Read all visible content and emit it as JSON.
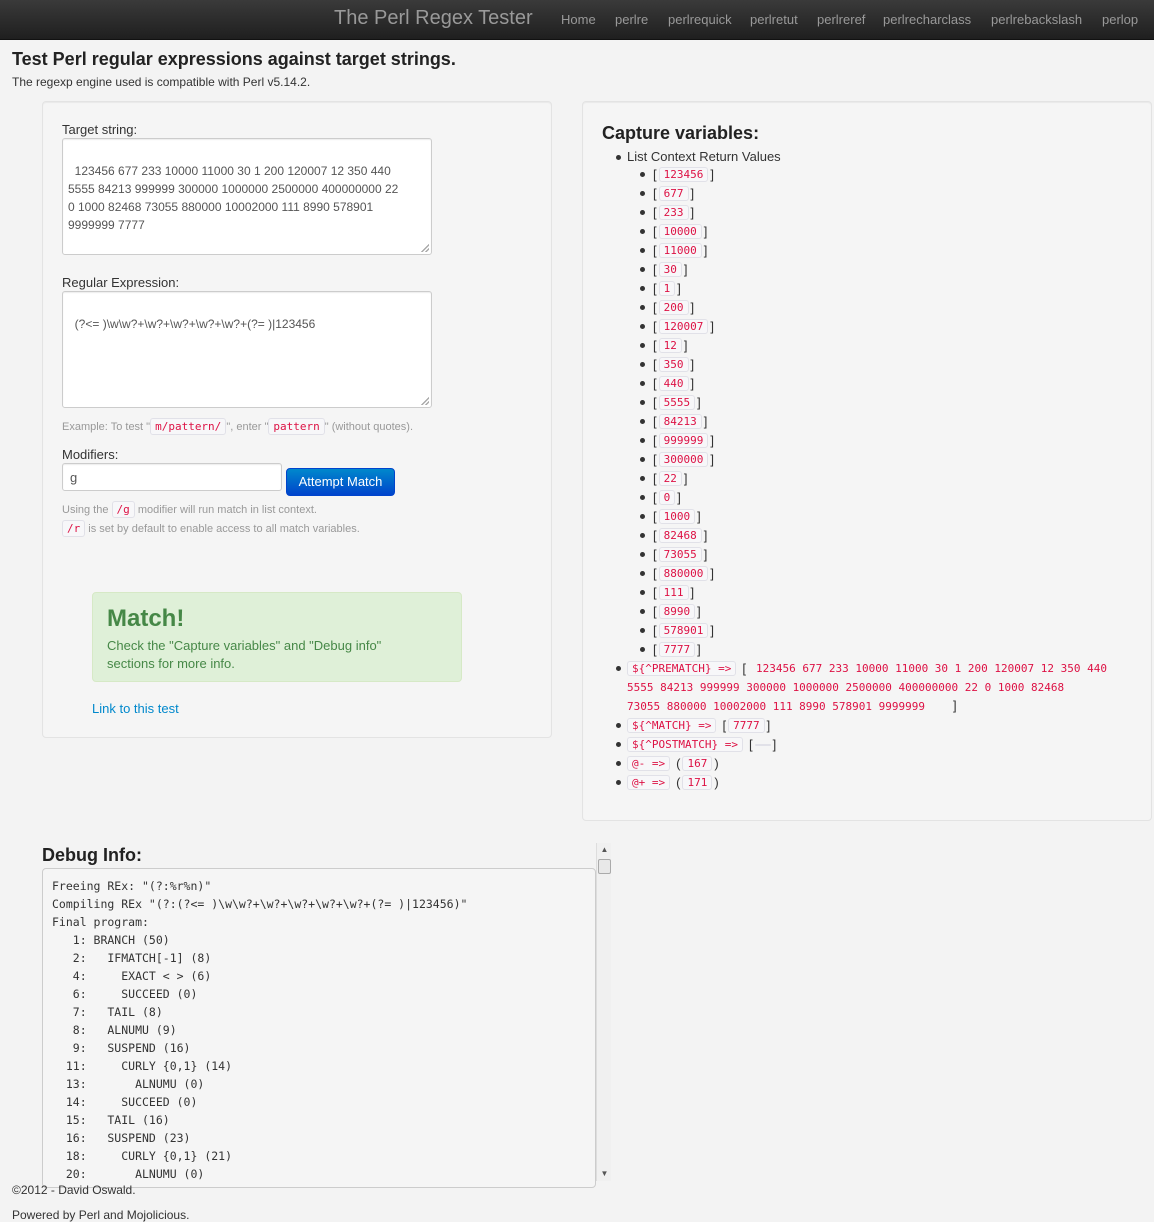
{
  "navbar": {
    "brand": "The Perl Regex Tester",
    "items": [
      "Home",
      "perlre",
      "perlrequick",
      "perlretut",
      "perlreref",
      "perlrecharclass",
      "perlrebackslash",
      "perlop"
    ]
  },
  "header": {
    "title": "Test Perl regular expressions against target strings.",
    "subtitle": "The regexp engine used is compatible with Perl v5.14.2."
  },
  "form": {
    "target_label": "Target string:",
    "target_value": "123456 677 233 10000 11000 30 1 200 120007 12 350 440\n5555 84213 999999 300000 1000000 2500000 400000000 22\n0 1000 82468 73055 880000 10002000 111 8990 578901\n9999999 7777",
    "regex_label": "Regular Expression:",
    "regex_value": "(?<= )\\w\\w?+\\w?+\\w?+\\w?+\\w?+(?= )|123456",
    "example_prefix": "Example: To test \"",
    "example_code1": "m/pattern/",
    "example_mid": "\", enter \"",
    "example_code2": "pattern",
    "example_suffix": "\" (without quotes).",
    "modifiers_label": "Modifiers:",
    "modifiers_value": "g",
    "attempt_button": "Attempt Match",
    "g_help_prefix": "Using the ",
    "g_help_code": "/g",
    "g_help_suffix": " modifier will run match in list context.",
    "r_help_code": "/r",
    "r_help_suffix": " is set by default to enable access to all match variables."
  },
  "result": {
    "title": "Match!",
    "text": "Check the \"Capture variables\" and \"Debug info\" sections for more info.",
    "link": "Link to this test"
  },
  "captures": {
    "title": "Capture variables:",
    "list_label": "List Context Return Values",
    "values": [
      "123456",
      "677",
      "233",
      "10000",
      "11000",
      "30",
      "1",
      "200",
      "120007",
      "12",
      "350",
      "440",
      "5555",
      "84213",
      "999999",
      "300000",
      "22",
      "0",
      "1000",
      "82468",
      "73055",
      "880000",
      "111",
      "8990",
      "578901",
      "7777"
    ],
    "open_bracket": "[",
    "close_bracket": "]",
    "prematch_label": "${^PREMATCH} =>",
    "prematch_value": "123456 677 233 10000 11000 30 1 200 120007 12 350 440\n5555 84213 999999 300000 1000000 2500000 400000000 22 0 1000 82468\n73055 880000 10002000 111 8990 578901 9999999",
    "match_label": "${^MATCH} =>",
    "match_value": "7777",
    "postmatch_label": "${^POSTMATCH} =>",
    "postmatch_value": " ",
    "minus_label": "@- =>",
    "minus_value": "167",
    "plus_label": "@+ =>",
    "plus_value": "171",
    "open_paren": "(",
    "close_paren": ")"
  },
  "debug": {
    "title": "Debug Info:",
    "text": "Freeing REx: \"(?:%r%n)\"\nCompiling REx \"(?:(?<= )\\w\\w?+\\w?+\\w?+\\w?+\\w?+(?= )|123456)\"\nFinal program:\n   1: BRANCH (50)\n   2:   IFMATCH[-1] (8)\n   4:     EXACT < > (6)\n   6:     SUCCEED (0)\n   7:   TAIL (8)\n   8:   ALNUMU (9)\n   9:   SUSPEND (16)\n  11:     CURLY {0,1} (14)\n  13:       ALNUMU (0)\n  14:     SUCCEED (0)\n  15:   TAIL (16)\n  16:   SUSPEND (23)\n  18:     CURLY {0,1} (21)\n  20:       ALNUMU (0)"
  },
  "footer": {
    "copyright": "©2012 - David Oswald.",
    "powered": "Powered by Perl and Mojolicious."
  },
  "colors": {
    "navbar": "#222222",
    "primary": "#0088cc",
    "success_bg": "#dff0d8",
    "success_text": "#468847",
    "code": "#dd1144"
  }
}
